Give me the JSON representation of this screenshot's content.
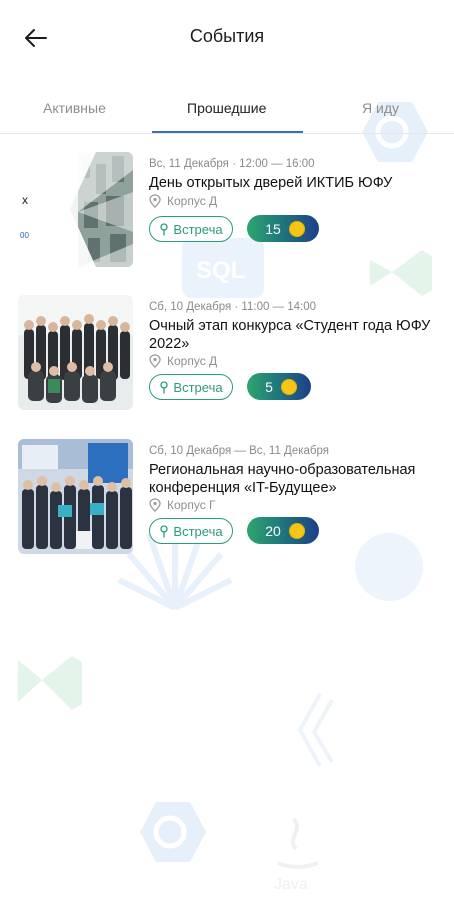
{
  "header": {
    "back_icon": "arrow-left-icon",
    "title": "События"
  },
  "tabs": [
    {
      "label": "Активные",
      "active": false
    },
    {
      "label": "Прошедшие",
      "active": true
    },
    {
      "label": "Я иду",
      "active": false
    }
  ],
  "colors": {
    "accent_blue": "#3b6fb6",
    "badge_green": "#2b9c7a",
    "coin_yellow": "#f5c518"
  },
  "events": [
    {
      "meta": "Вс, 11 Декабря · 12:00 — 16:00",
      "title": "День открытых дверей ИКТИБ ЮФУ",
      "location": "Корпус Д",
      "type": "Встреча",
      "points": "15",
      "thumb_text_top": "х",
      "thumb_text_bottom": "00"
    },
    {
      "meta": "Сб, 10 Декабря · 11:00 — 14:00",
      "title": "Очный этап конкурса «Студент года ЮФУ 2022»",
      "location": "Корпус Д",
      "type": "Встреча",
      "points": "5"
    },
    {
      "meta": "Сб, 10 Декабря — Вс, 11 Декабря",
      "title": "Региональная научно-образовательная конференция «IT-Будущее»",
      "location": "Корпус Г",
      "type": "Встреча",
      "points": "20"
    }
  ],
  "background_icons": [
    "csharp-icon",
    "sql-icon",
    "visual-studio-icon",
    "java-icon",
    "braces-icon",
    "fan-icon"
  ]
}
